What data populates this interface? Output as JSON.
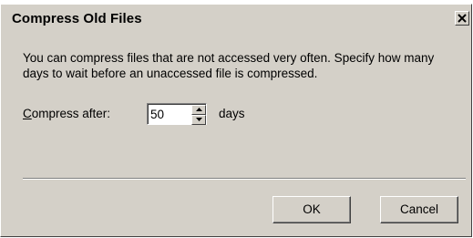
{
  "window": {
    "title": "Compress Old Files",
    "close_icon": "close-icon"
  },
  "content": {
    "description_line1": "You can compress files that are not accessed very often. Specify how many",
    "description_line2": "days to wait before an unaccessed file is compressed.",
    "compress_label_first": "C",
    "compress_label_rest": "ompress after:",
    "days_value": "50",
    "days_unit": "days"
  },
  "buttons": {
    "ok_label": "OK",
    "cancel_label": "Cancel"
  },
  "colors": {
    "dialog_face": "#d4d0c8",
    "highlight": "#ffffff",
    "shadow": "#808080",
    "dark_shadow": "#404040"
  }
}
